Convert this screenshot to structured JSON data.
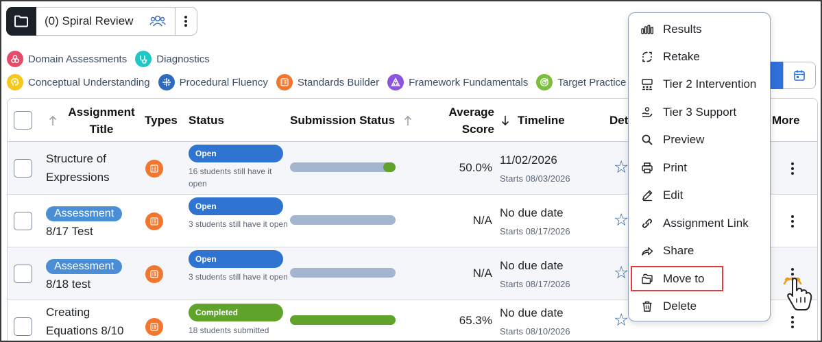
{
  "folder": {
    "name": "(0) Spiral Review"
  },
  "legend": [
    {
      "label": "Domain Assessments",
      "color": "#e84b6a"
    },
    {
      "label": "Diagnostics",
      "color": "#1fc7c7"
    },
    {
      "label": "Conceptual Understanding",
      "color": "#f7c81b"
    },
    {
      "label": "Procedural Fluency",
      "color": "#2d6bbf"
    },
    {
      "label": "Standards Builder",
      "color": "#f2762e"
    },
    {
      "label": "Framework Fundamentals",
      "color": "#8b55e0"
    },
    {
      "label": "Target Practice",
      "color": "#7cbf3a"
    }
  ],
  "table": {
    "headers": {
      "title": "Assignment Title",
      "types": "Types",
      "status": "Status",
      "submission": "Submission Status",
      "average": "Average Score",
      "timeline": "Timeline",
      "details": "Det",
      "more": "More"
    },
    "rows": [
      {
        "title": "Structure of Expressions",
        "badge": "",
        "status": "Open",
        "status_color": "#2f74d0",
        "note": "16 students still have it open",
        "progress": 0.1,
        "score": "50.0%",
        "due": "11/02/2026",
        "starts": "Starts 08/03/2026"
      },
      {
        "title": "8/17 Test",
        "badge": "Assessment",
        "status": "Open",
        "status_color": "#2f74d0",
        "note": "3 students still have it open",
        "progress": 0,
        "score": "N/A",
        "due": "No due date",
        "starts": "Starts 08/17/2026"
      },
      {
        "title": "8/18 test",
        "badge": "Assessment",
        "status": "Open",
        "status_color": "#2f74d0",
        "note": "3 students still have it open",
        "progress": 0,
        "score": "N/A",
        "due": "No due date",
        "starts": "Starts 08/17/2026"
      },
      {
        "title": "Creating Equations 8/10",
        "badge": "",
        "status": "Completed",
        "status_color": "#5fa32b",
        "note": "18 students submitted",
        "progress": 1,
        "score": "65.3%",
        "due": "No due date",
        "starts": "Starts 08/10/2026"
      }
    ]
  },
  "menu": {
    "items": [
      {
        "label": "Results",
        "icon": "bar-chart-icon"
      },
      {
        "label": "Retake",
        "icon": "retake-icon"
      },
      {
        "label": "Tier 2 Intervention",
        "icon": "tier2-icon"
      },
      {
        "label": "Tier 3 Support",
        "icon": "tier3-icon"
      },
      {
        "label": "Preview",
        "icon": "search-icon"
      },
      {
        "label": "Print",
        "icon": "printer-icon"
      },
      {
        "label": "Edit",
        "icon": "pencil-icon"
      },
      {
        "label": "Assignment Link",
        "icon": "link-icon"
      },
      {
        "label": "Share",
        "icon": "share-icon"
      },
      {
        "label": "Move to",
        "icon": "folder-move-icon"
      },
      {
        "label": "Delete",
        "icon": "trash-icon"
      }
    ],
    "highlighted": "Move to",
    "highlight_color": "#e0393e"
  }
}
